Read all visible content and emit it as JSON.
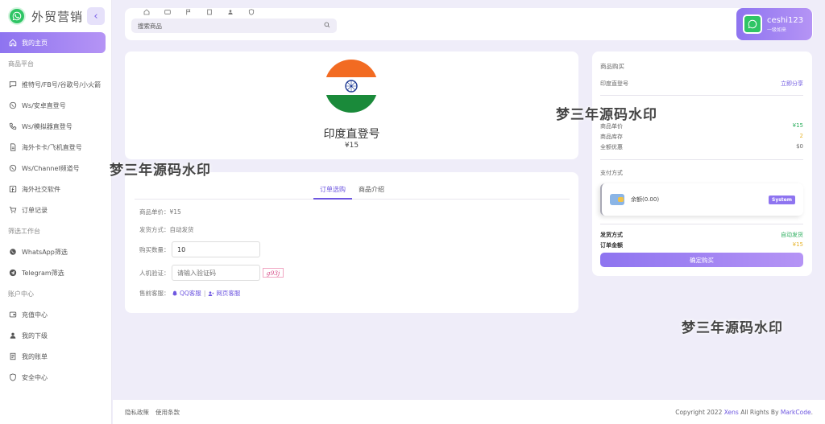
{
  "brand": {
    "title": "外贸营销",
    "collapse_icon": "chevron-left-icon"
  },
  "sidebar": {
    "home": {
      "label": "我的主页",
      "icon": "home-icon"
    },
    "sections": [
      {
        "title": "商品平台",
        "items": [
          {
            "label": "推特号/FB号/谷歌号/小火箭",
            "icon": "message-icon"
          },
          {
            "label": "Ws/安卓直登号",
            "icon": "whatsapp-icon"
          },
          {
            "label": "Ws/模拟器直登号",
            "icon": "phone-icon"
          },
          {
            "label": "海外卡卡/飞机直登号",
            "icon": "file-icon"
          },
          {
            "label": "Ws/Channel频道号",
            "icon": "whatsapp-icon"
          },
          {
            "label": "海外社交软件",
            "icon": "facebook-icon"
          },
          {
            "label": "订单记录",
            "icon": "cart-icon"
          }
        ]
      },
      {
        "title": "筛选工作台",
        "items": [
          {
            "label": "WhatsApp筛选",
            "icon": "whatsapp-icon"
          },
          {
            "label": "Telegram筛选",
            "icon": "telegram-icon"
          }
        ]
      },
      {
        "title": "账户中心",
        "items": [
          {
            "label": "充值中心",
            "icon": "wallet-icon"
          },
          {
            "label": "我的下级",
            "icon": "user-icon"
          },
          {
            "label": "我的账单",
            "icon": "bill-icon"
          },
          {
            "label": "安全中心",
            "icon": "shield-icon"
          }
        ]
      }
    ]
  },
  "header": {
    "search_placeholder": "搜索商品",
    "user": {
      "name": "ceshi123",
      "level": "一级如来"
    }
  },
  "product": {
    "name": "印度直登号",
    "price": "¥15",
    "flag_colors": {
      "saffron": "#f26b22",
      "white": "#ffffff",
      "green": "#1a8a3a",
      "chakra": "#1f3a93"
    }
  },
  "order": {
    "tabs": [
      "订单选购",
      "商品介绍"
    ],
    "unit_price": "商品单价：¥15",
    "delivery": "发货方式：自动发货",
    "quantity_label": "购买数量：",
    "quantity_value": "10",
    "captcha_label": "人机验证：",
    "captcha_placeholder": "请输入验证码",
    "captcha_code": "g93j",
    "service_label": "售前客服：",
    "qq_service": "QQ客服",
    "separator": "|",
    "web_service": "网页客服"
  },
  "purchase": {
    "title": "商品购买",
    "product_name": "印度直登号",
    "share": "立即分享",
    "unit_price_label": "商品单价",
    "unit_price": "¥15",
    "stock_label": "商品库存",
    "stock": "2",
    "discount_label": "全额优惠",
    "discount": "$0",
    "payment_title": "支付方式",
    "balance": "余额(0.00)",
    "system_badge": "System",
    "delivery_label": "发货方式",
    "delivery_value": "自动发货",
    "total_label": "订单金额",
    "total_value": "¥15",
    "buy_button": "确定购买"
  },
  "watermarks": [
    "梦三年源码水印",
    "梦三年源码水印",
    "梦三年源码水印"
  ],
  "footer": {
    "links": [
      "隐私政策",
      "使用条款"
    ],
    "copyright_prefix": "Copyright 2022 ",
    "copyright_brand": "Xens",
    "copyright_mid": " All Rights By ",
    "copyright_author": "MarkCode",
    "copyright_suffix": "."
  }
}
